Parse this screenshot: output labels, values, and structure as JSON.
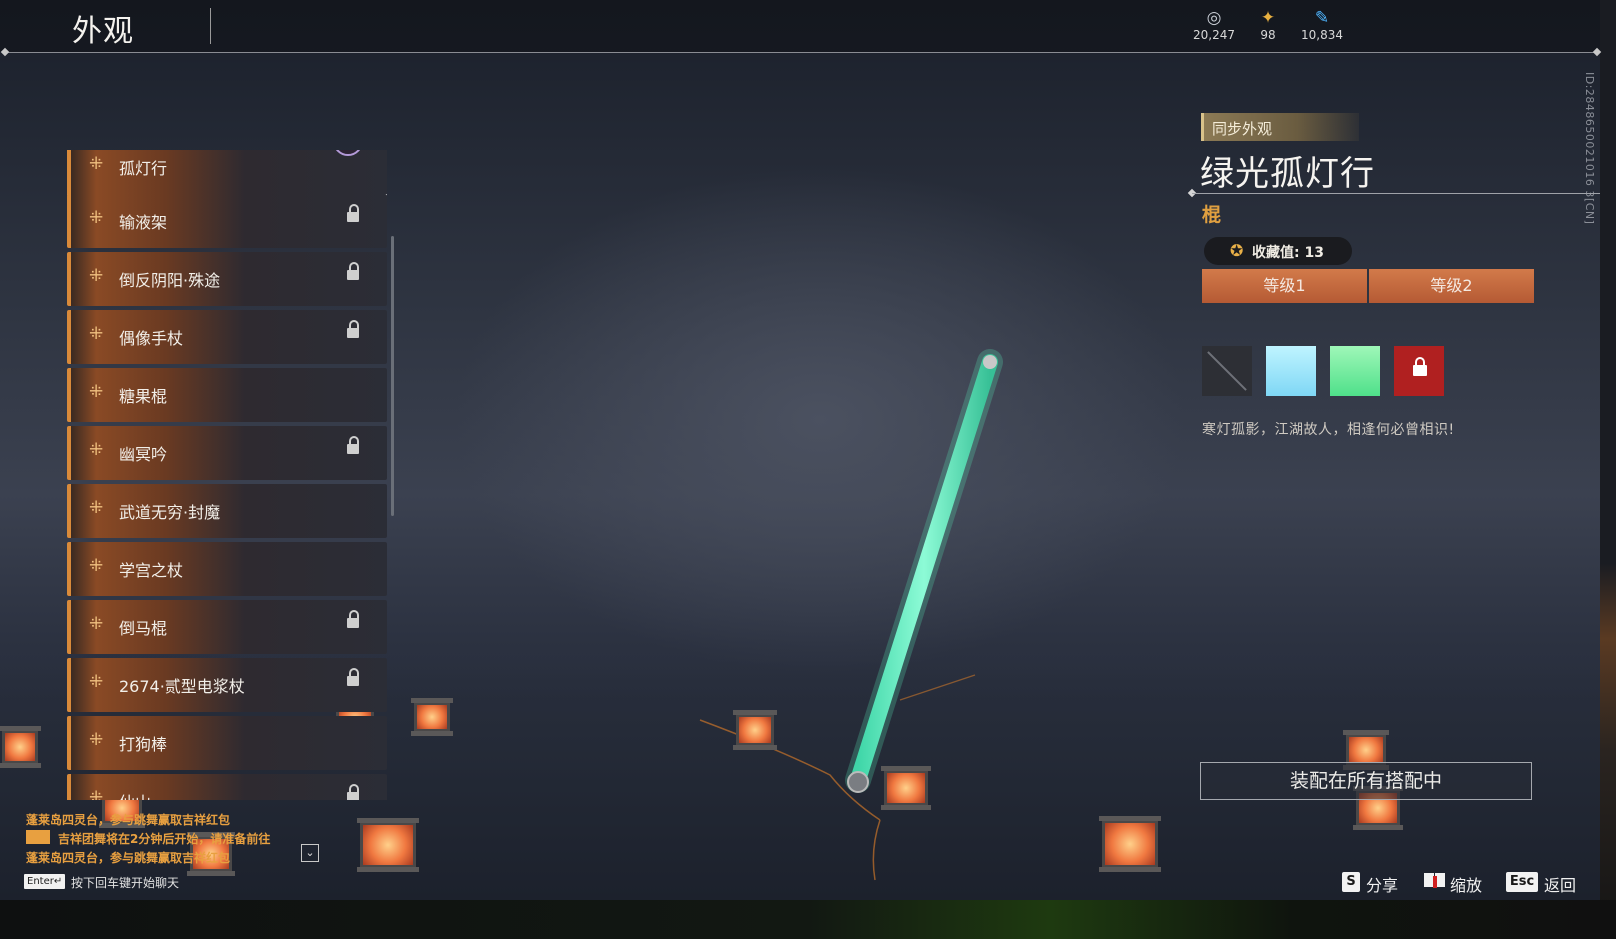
{
  "header": {
    "title": "外观",
    "currencies": [
      {
        "icon": "silver-coin-icon",
        "symbol": "◎",
        "value": "20,247",
        "color": "#c8cdd4"
      },
      {
        "icon": "ticket-icon",
        "symbol": "✦",
        "value": "98",
        "color": "#e8b040"
      },
      {
        "icon": "feather-icon",
        "symbol": "✎",
        "value": "10,834",
        "color": "#4fb6ff"
      }
    ]
  },
  "build_id": "ID:2848650021016 3[CN]",
  "list": {
    "items": [
      {
        "label": "孤灯行",
        "locked": false,
        "selected": true
      },
      {
        "label": "输液架",
        "locked": true
      },
      {
        "label": "倒反阴阳·殊途",
        "locked": true
      },
      {
        "label": "偶像手杖",
        "locked": true
      },
      {
        "label": "糖果棍",
        "locked": false
      },
      {
        "label": "幽冥吟",
        "locked": true
      },
      {
        "label": "武道无穷·封魔",
        "locked": false
      },
      {
        "label": "学宫之杖",
        "locked": false
      },
      {
        "label": "倒马棍",
        "locked": true
      },
      {
        "label": "2674·贰型电浆杖",
        "locked": true
      },
      {
        "label": "打狗棒",
        "locked": false
      },
      {
        "label": "仙山",
        "locked": true
      }
    ],
    "item_glyph": "⁜",
    "check_glyph": "✓"
  },
  "detail": {
    "sync_tag": "同步外观",
    "name": "绿光孤灯行",
    "type": "棍",
    "collect_icon": "✪",
    "collect_value": "收藏值: 13",
    "levels": [
      "等级1",
      "等级2"
    ],
    "swatches": [
      {
        "name": "none",
        "color": "#2d2f35"
      },
      {
        "name": "ice-blue",
        "color": "#9fe6fb"
      },
      {
        "name": "mint-green",
        "color": "#6fea9c"
      },
      {
        "name": "locked-red",
        "color": "#b02020",
        "locked": true
      }
    ],
    "description": "寒灯孤影，江湖故人，相逢何必曾相识!",
    "equip_button": "装配在所有搭配中"
  },
  "chat": {
    "lines": [
      "蓬莱岛四灵台，参与跳舞赢取吉祥红包",
      "吉祥团舞将在2分钟后开始，请准备前往",
      "蓬莱岛四灵台，参与跳舞赢取吉祥红包"
    ],
    "expand_glyph": "⌄",
    "enter_key": "Enter↵",
    "hint": "按下回车键开始聊天"
  },
  "controls": [
    {
      "key": "S",
      "label": "分享"
    },
    {
      "key": "book",
      "label": "缩放"
    },
    {
      "key": "Esc",
      "label": "返回"
    }
  ]
}
